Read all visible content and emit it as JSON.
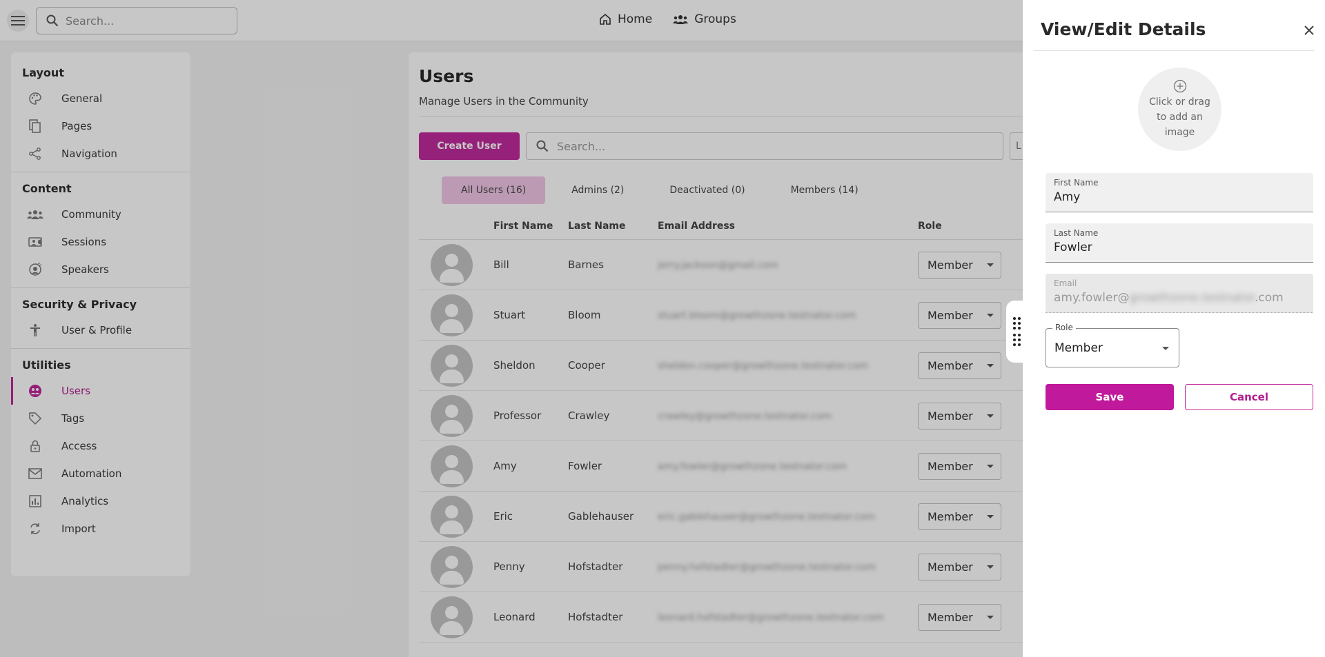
{
  "topbar": {
    "search_placeholder": "Search...",
    "nav": [
      {
        "label": "Home",
        "icon": "home-icon"
      },
      {
        "label": "Groups",
        "icon": "groups-icon"
      }
    ]
  },
  "sidebar": {
    "sections": [
      {
        "heading": "Layout",
        "items": [
          {
            "label": "General",
            "icon": "palette-icon"
          },
          {
            "label": "Pages",
            "icon": "pages-icon"
          },
          {
            "label": "Navigation",
            "icon": "share-icon"
          }
        ]
      },
      {
        "heading": "Content",
        "items": [
          {
            "label": "Community",
            "icon": "community-icon"
          },
          {
            "label": "Sessions",
            "icon": "video-icon"
          },
          {
            "label": "Speakers",
            "icon": "speaker-icon"
          }
        ]
      },
      {
        "heading": "Security & Privacy",
        "items": [
          {
            "label": "User & Profile",
            "icon": "accessibility-icon"
          }
        ]
      },
      {
        "heading": "Utilities",
        "items": [
          {
            "label": "Users",
            "icon": "users-icon",
            "active": true
          },
          {
            "label": "Tags",
            "icon": "tag-icon"
          },
          {
            "label": "Access",
            "icon": "lock-icon"
          },
          {
            "label": "Automation",
            "icon": "mail-icon"
          },
          {
            "label": "Analytics",
            "icon": "analytics-icon"
          },
          {
            "label": "Import",
            "icon": "sync-icon"
          }
        ]
      }
    ]
  },
  "main": {
    "title": "Users",
    "subtitle": "Manage Users in the Community",
    "create_button": "Create User",
    "search_placeholder": "Search...",
    "extra_button": "L",
    "tabs": [
      {
        "label": "All Users (16)",
        "active": true
      },
      {
        "label": "Admins (2)"
      },
      {
        "label": "Deactivated (0)"
      },
      {
        "label": "Members (14)"
      }
    ],
    "columns": [
      "",
      "First Name",
      "Last Name",
      "Email Address",
      "Role"
    ],
    "rows": [
      {
        "first": "Bill",
        "last": "Barnes",
        "email": "jerry.jackson@gmail.com",
        "role": "Member"
      },
      {
        "first": "Stuart",
        "last": "Bloom",
        "email": "stuart.bloom@growthzone.testnator.com",
        "role": "Member"
      },
      {
        "first": "Sheldon",
        "last": "Cooper",
        "email": "sheldon.cooper@growthzone.testnator.com",
        "role": "Member"
      },
      {
        "first": "Professor",
        "last": "Crawley",
        "email": "crawley@growthzone.testnator.com",
        "role": "Member"
      },
      {
        "first": "Amy",
        "last": "Fowler",
        "email": "amy.fowler@growthzone.testnator.com",
        "role": "Member"
      },
      {
        "first": "Eric",
        "last": "Gablehauser",
        "email": "eric.gablehauser@growthzone.testnator.com",
        "role": "Member"
      },
      {
        "first": "Penny",
        "last": "Hofstadter",
        "email": "penny.hofstadter@growthzone.testnator.com",
        "role": "Member"
      },
      {
        "first": "Leonard",
        "last": "Hofstadter",
        "email": "leonard.hofstadter@growthzone.testnator.com",
        "role": "Member"
      }
    ]
  },
  "panel": {
    "title": "View/Edit Details",
    "upload_text": "Click or drag to add an image",
    "first_name_label": "First Name",
    "first_name": "Amy",
    "last_name_label": "Last Name",
    "last_name": "Fowler",
    "email_label": "Email",
    "email_prefix": "amy.fowler@",
    "email_hidden": "growthzone.testnator",
    "email_suffix": ".com",
    "role_label": "Role",
    "role_value": "Member",
    "save": "Save",
    "cancel": "Cancel"
  },
  "colors": {
    "accent": "#c0199b",
    "tab_active_bg": "#f3c6e6"
  }
}
